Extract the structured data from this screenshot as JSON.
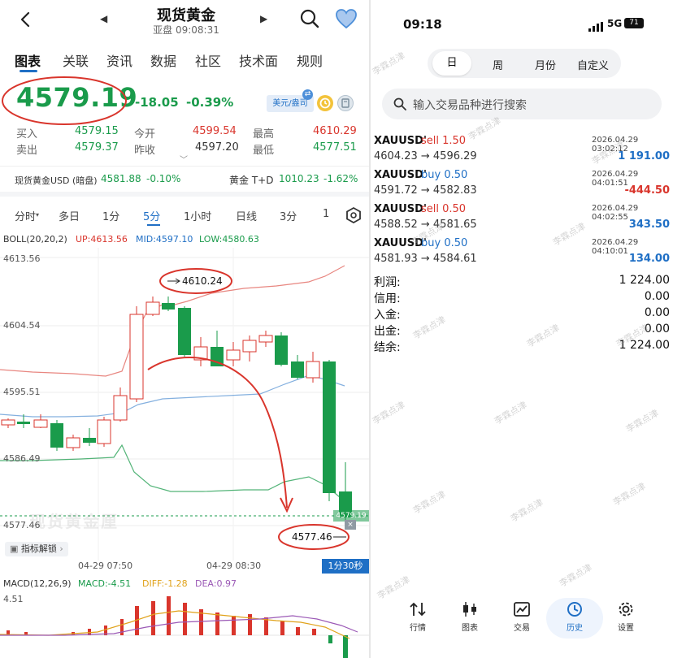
{
  "left": {
    "header": {
      "title": "现货黄金",
      "subtitle": "亚盘 09:08:31"
    },
    "tabs": [
      {
        "label": "图表",
        "active": true
      },
      {
        "label": "关联"
      },
      {
        "label": "资讯"
      },
      {
        "label": "数据"
      },
      {
        "label": "社区"
      },
      {
        "label": "技术面"
      },
      {
        "label": "规则"
      }
    ],
    "quote": {
      "price": "4579.19",
      "change": "-18.05",
      "change_pct": "-0.39%",
      "currency_badge": "美元/盎司",
      "rows": [
        {
          "l1": "买入",
          "v1": "4579.15",
          "l2": "今开",
          "v2": "4599.54",
          "l3": "最高",
          "v3": "4610.29"
        },
        {
          "l1": "卖出",
          "v1": "4579.37",
          "l2": "昨收",
          "v2": "4597.20",
          "l3": "最低",
          "v3": "4577.51"
        }
      ]
    },
    "related": {
      "a_name": "现货黄金USD (暗盘)",
      "a_price": "4581.88",
      "a_pct": "-0.10%",
      "b_name": "黄金 T+D",
      "b_price": "1010.23",
      "b_pct": "-1.62%"
    },
    "periods": [
      {
        "label": "分时"
      },
      {
        "label": "多日"
      },
      {
        "label": "1分"
      },
      {
        "label": "5分",
        "active": true
      },
      {
        "label": "1小时"
      },
      {
        "label": "日线"
      },
      {
        "label": "3分"
      },
      {
        "label": "1"
      }
    ],
    "boll": {
      "title": "BOLL(20,20,2)",
      "up": "UP:4613.56",
      "mid": "MID:4597.10",
      "low": "LOW:4580.63"
    },
    "price_axis": [
      "4613.56",
      "4604.54",
      "4595.51",
      "4586.49",
      "4577.46"
    ],
    "annotation_high": "4610.24",
    "annotation_low": "4577.46",
    "current_tag": "4579.19",
    "chart_watermark": "现货黄金厘",
    "indicator_button": "指标解锁",
    "time_axis": [
      "04-29 07:50",
      "04-29 08:30"
    ],
    "countdown": "1分30秒",
    "macd": {
      "title": "MACD(12,26,9)",
      "macd": "MACD:-4.51",
      "diff": "DIFF:-1.28",
      "dea": "DEA:0.97",
      "axis_top": "4.51"
    }
  },
  "right": {
    "status": {
      "time": "09:18",
      "network": "5G",
      "battery": "71"
    },
    "periods": [
      {
        "label": "日",
        "active": true
      },
      {
        "label": "周"
      },
      {
        "label": "月份"
      },
      {
        "label": "自定义"
      }
    ],
    "search_placeholder": "输入交易品种进行搜索",
    "trades": [
      {
        "symbol": "XAUUSD'",
        "side": "sell 1.50",
        "datetime": "2026.04.29 03:02:12",
        "prices": "4604.23 → 4596.29",
        "profit": "1 191.00"
      },
      {
        "symbol": "XAUUSD'",
        "side": "buy 0.50",
        "datetime": "2026.04.29 04:01:51",
        "prices": "4591.72 → 4582.83",
        "profit": "-444.50"
      },
      {
        "symbol": "XAUUSD'",
        "side": "sell 0.50",
        "datetime": "2026.04.29 04:02:55",
        "prices": "4588.52 → 4581.65",
        "profit": "343.50"
      },
      {
        "symbol": "XAUUSD'",
        "side": "buy 0.50",
        "datetime": "2026.04.29 04:10:01",
        "prices": "4581.93 → 4584.61",
        "profit": "134.00"
      }
    ],
    "summary": [
      {
        "label": "利润:",
        "value": "1 224.00"
      },
      {
        "label": "信用:",
        "value": "0.00"
      },
      {
        "label": "入金:",
        "value": "0.00"
      },
      {
        "label": "出金:",
        "value": "0.00"
      },
      {
        "label": "结余:",
        "value": "1 224.00"
      }
    ],
    "nav": [
      {
        "label": "行情",
        "icon": "quotes-icon"
      },
      {
        "label": "图表",
        "icon": "chart-icon"
      },
      {
        "label": "交易",
        "icon": "trade-icon"
      },
      {
        "label": "历史",
        "icon": "history-icon",
        "active": true
      },
      {
        "label": "设置",
        "icon": "settings-icon"
      }
    ],
    "watermark": "李霖点津"
  },
  "colors": {
    "up": "#d9352c",
    "down": "#1a9b4b",
    "accent": "#1f6fc5"
  }
}
